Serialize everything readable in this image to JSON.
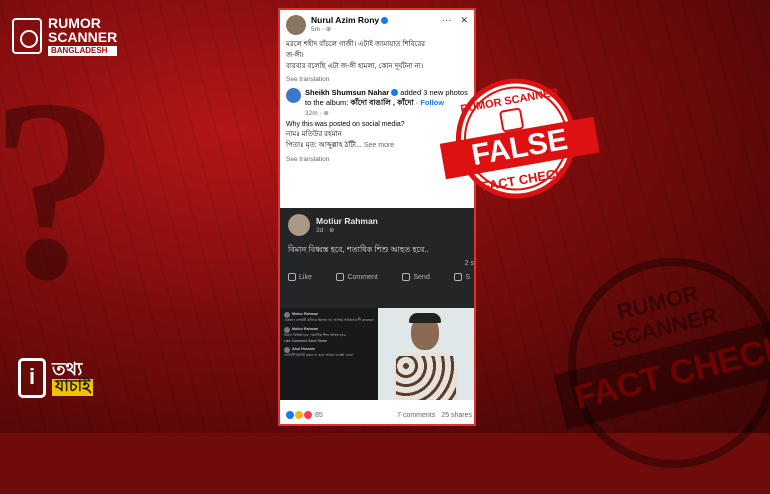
{
  "brand": {
    "line1": "RUMOR",
    "line2": "SCANNER",
    "line3": "BANGLADESH"
  },
  "tathya": {
    "line1": "তথ্য",
    "line2": "যাচাই"
  },
  "bg_stamp": {
    "top": "RUMOR SCANNER",
    "band": "FACT CHECK"
  },
  "false_stamp": {
    "top": "RUMOR SCANNER",
    "band": "FALSE",
    "bottom": "FACT CHECK"
  },
  "post": {
    "author": "Nurul Azim Rony",
    "meta": "5m · ⊕",
    "body_lines": [
      "মরলে শহীদ বাঁচলে গাজী। এটাই জামায়াত শিবিরের",
      "জ-ঙ্গী।",
      "বারবার বলেছি এটা জ-ঙ্গী হামলা, কোন দূর্ঘটনা না।"
    ],
    "see_translation": "See translation",
    "shared": {
      "author": "Sheikh Shumsun Nahar",
      "action": "added 3 new photos to the album:",
      "album": "কাঁদো বাঙালি , কাঁদো",
      "follow": "Follow",
      "meta": "32m · ⊕",
      "lines": [
        "Why this was posted on social media?",
        "নামঃ মতিউর রহমান",
        "পিতাঃ মৃত: আব্দুল্লাহ ঠাঁটী..."
      ],
      "see_more": "See more",
      "see_translation": "See translation"
    },
    "dark_post": {
      "author": "Motiur Rahman",
      "meta": "3d · ⊕",
      "text": "বিমান বিধ্বস্ত হবে, শতাধিক শিশু আহত হবে..",
      "time": "2 s",
      "like": "Like",
      "comment": "Comment",
      "send": "Send",
      "share": "S"
    },
    "mini": {
      "n1": "Motiur Rahman",
      "t1": "একজন লেখাটি বানিয়ে ছিলেন না, আগাম ভবিষ্যৎবাণী করেছেন",
      "n2": "Motiur Rahman",
      "t2": "বিমান বিধ্বস্ত হবে, শতাধিক শিশু আহত হবে..",
      "acts": "Like  Comment  Send  Share",
      "n3": "Abul Hossain",
      "t3": "লেখাটি ডিলিট করুন না হলে আমরা ব্যবস্থা নেবো"
    },
    "reactions": "85",
    "comments": "7 comments",
    "shares": "25 shares"
  }
}
